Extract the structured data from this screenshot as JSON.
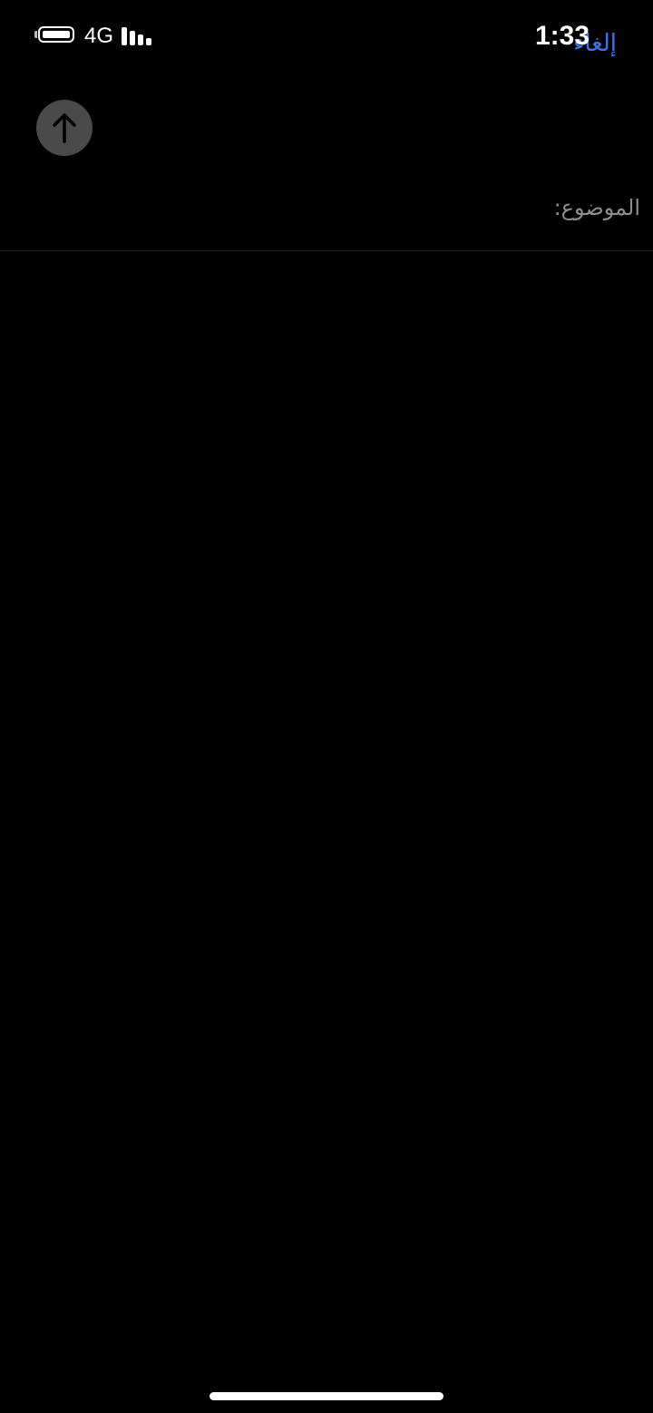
{
  "status_bar": {
    "network": "4G",
    "time": "1:33",
    "battery_icon": "battery-icon",
    "signal_icon": "signal-bars-icon"
  },
  "nav": {
    "cancel_label": "إلغاء",
    "accent_color": "#3478f6"
  },
  "compose": {
    "send_icon": "arrow-up-icon",
    "subject_label": "الموضوع:",
    "subject_value": ""
  }
}
